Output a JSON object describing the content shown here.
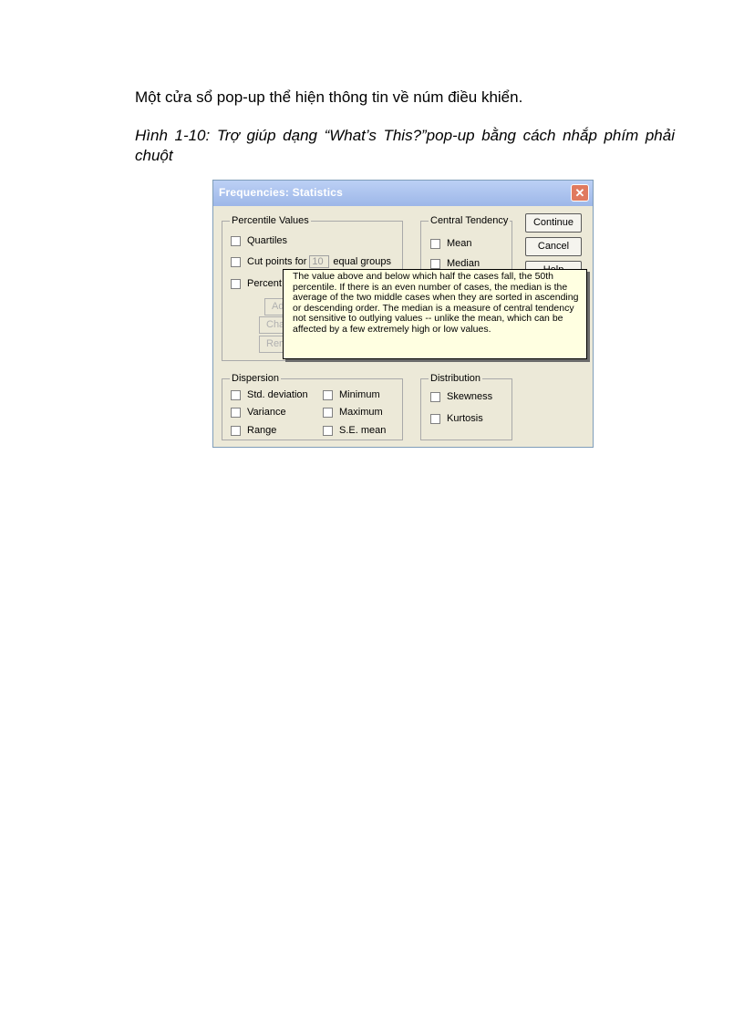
{
  "document": {
    "paragraph": "Một cửa sổ pop-up thể hiện thông tin về núm điều khiển.",
    "caption": "Hình 1-10: Trợ giúp dạng “What’s This?”pop-up  bằng cách nhắp phím phải chuột"
  },
  "dialog": {
    "title": "Frequencies: Statistics",
    "close_glyph": "✕",
    "percentile_group": {
      "label": "Percentile Values",
      "quartiles": "Quartiles",
      "cut_points_prefix": "Cut points for",
      "cut_points_value": "10",
      "cut_points_suffix": "equal groups",
      "percentiles": "Percentile(s):",
      "buttons": [
        "Add",
        "Change",
        "Remove"
      ]
    },
    "central_group": {
      "label": "Central Tendency",
      "mean": "Mean",
      "median": "Median"
    },
    "buttons": {
      "continue": "Continue",
      "cancel": "Cancel",
      "help": "Help"
    },
    "dispersion_group": {
      "label": "Dispersion",
      "std_deviation": "Std. deviation",
      "minimum": "Minimum",
      "variance": "Variance",
      "maximum": "Maximum",
      "range": "Range",
      "se_mean": "S.E. mean"
    },
    "distribution_group": {
      "label": "Distribution",
      "skewness": "Skewness",
      "kurtosis": "Kurtosis"
    },
    "tooltip": {
      "text": "The value above and below which half the cases fall, the 50th percentile. If there is an even number of cases, the median is the average of the two middle cases when they are sorted in ascending or descending order. The median is a measure of central tendency not sensitive to outlying values -- unlike the mean, which can be affected by a few extremely high or low values."
    }
  },
  "colors": {
    "dialog_bg": "#ece9d8",
    "titlebar": "#9db7e8",
    "close_button": "#e07a5f",
    "tooltip_bg": "#ffffe1"
  }
}
